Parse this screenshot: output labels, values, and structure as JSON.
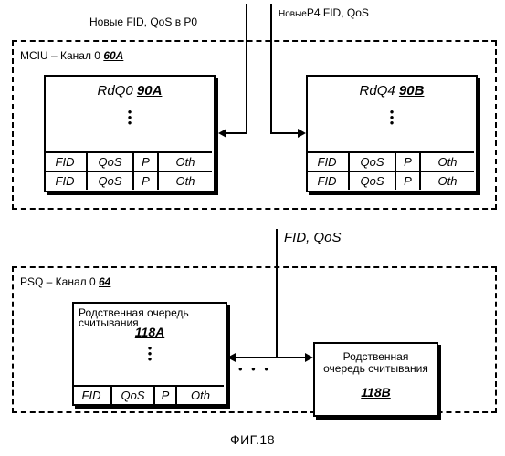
{
  "figure": {
    "caption": "ФИГ.18"
  },
  "callouts": {
    "top_left": "Новые FID, QoS в P0",
    "top_right_prefix": "Новые",
    "top_right_main": "P4 FID, QoS",
    "middle": "FID, QoS",
    "ellipsis": "• • •"
  },
  "groups": [
    {
      "name": "mciu",
      "label_text": "MCIU – Канал 0 ",
      "label_ref": "60A"
    },
    {
      "name": "psq",
      "label_text": "PSQ – Канал 0 ",
      "label_ref": "64"
    }
  ],
  "queues": {
    "rdq0": {
      "title_text": "RdQ0 ",
      "title_ref": "90A",
      "dots": [
        "•",
        "•",
        "•"
      ],
      "rows": [
        [
          "FID",
          "QoS",
          "P",
          "Oth"
        ],
        [
          "FID",
          "QoS",
          "P",
          "Oth"
        ]
      ]
    },
    "rdq4": {
      "title_text": "RdQ4 ",
      "title_ref": "90B",
      "dots": [
        "•",
        "•",
        "•"
      ],
      "rows": [
        [
          "FID",
          "QoS",
          "P",
          "Oth"
        ],
        [
          "FID",
          "QoS",
          "P",
          "Oth"
        ]
      ]
    },
    "sibling_a": {
      "title_line1": "Родственная очередь",
      "title_line2": "считывания",
      "title_ref": "118A",
      "dots": [
        "•",
        "•",
        "•"
      ],
      "rows": [
        [
          "FID",
          "QoS",
          "P",
          "Oth"
        ]
      ]
    },
    "sibling_b": {
      "title_line1": "Родственная",
      "title_line2": "очередь считывания",
      "title_ref": "118B"
    }
  },
  "colors": {
    "ink": "#000000",
    "paper": "#ffffff"
  }
}
